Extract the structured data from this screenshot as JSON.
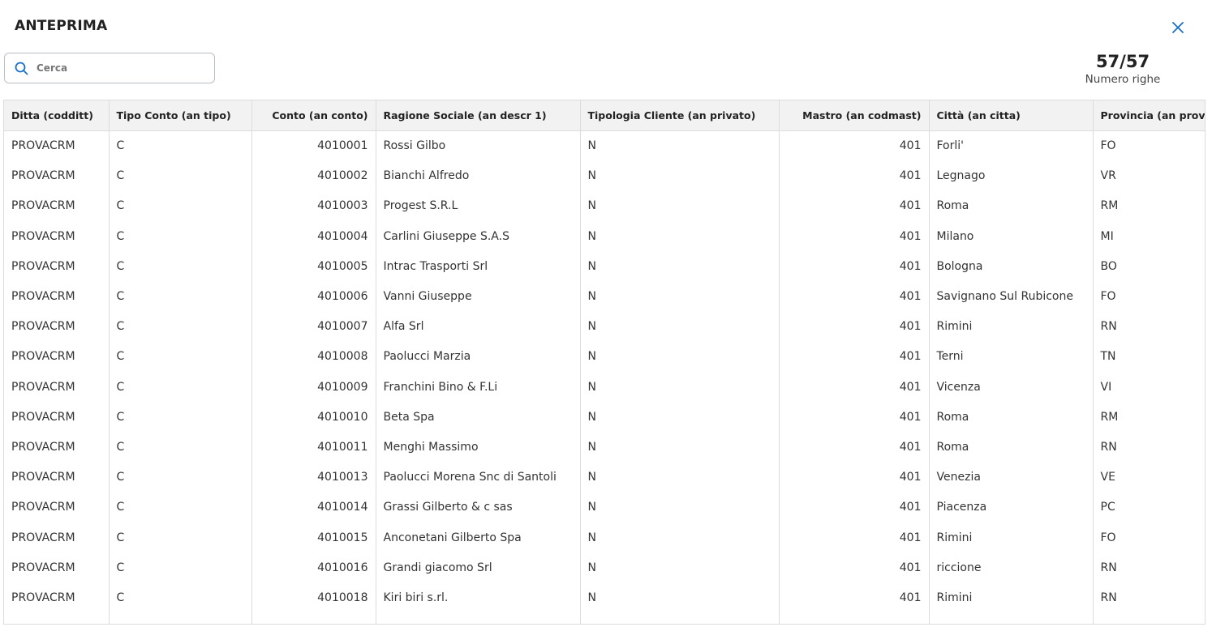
{
  "dialog": {
    "title": "ANTEPRIMA",
    "close_icon": "close-icon",
    "accent_color": "#1a6fc9"
  },
  "search": {
    "placeholder": "Cerca",
    "value": "",
    "icon": "search-icon"
  },
  "counter": {
    "count": "57/57",
    "label": "Numero righe"
  },
  "table": {
    "columns": [
      "Ditta (codditt)",
      "Tipo Conto (an tipo)",
      "Conto (an conto)",
      "Ragione Sociale (an descr 1)",
      "Tipologia Cliente (an privato)",
      "Mastro (an codmast)",
      "Città (an citta)",
      "Provincia (an prov)"
    ],
    "rows": [
      [
        "PROVACRM",
        "C",
        "4010001",
        "Rossi Gilbo",
        "N",
        "401",
        "Forli'",
        "FO"
      ],
      [
        "PROVACRM",
        "C",
        "4010002",
        "Bianchi Alfredo",
        "N",
        "401",
        "Legnago",
        "VR"
      ],
      [
        "PROVACRM",
        "C",
        "4010003",
        "Progest S.R.L",
        "N",
        "401",
        "Roma",
        "RM"
      ],
      [
        "PROVACRM",
        "C",
        "4010004",
        "Carlini Giuseppe S.A.S",
        "N",
        "401",
        "Milano",
        "MI"
      ],
      [
        "PROVACRM",
        "C",
        "4010005",
        "Intrac Trasporti Srl",
        "N",
        "401",
        "Bologna",
        "BO"
      ],
      [
        "PROVACRM",
        "C",
        "4010006",
        "Vanni Giuseppe",
        "N",
        "401",
        "Savignano Sul Rubicone",
        "FO"
      ],
      [
        "PROVACRM",
        "C",
        "4010007",
        "Alfa Srl",
        "N",
        "401",
        "Rimini",
        "RN"
      ],
      [
        "PROVACRM",
        "C",
        "4010008",
        "Paolucci Marzia",
        "N",
        "401",
        "Terni",
        "TN"
      ],
      [
        "PROVACRM",
        "C",
        "4010009",
        "Franchini Bino & F.Li",
        "N",
        "401",
        "Vicenza",
        "VI"
      ],
      [
        "PROVACRM",
        "C",
        "4010010",
        "Beta Spa",
        "N",
        "401",
        "Roma",
        "RM"
      ],
      [
        "PROVACRM",
        "C",
        "4010011",
        "Menghi Massimo",
        "N",
        "401",
        "Roma",
        "RN"
      ],
      [
        "PROVACRM",
        "C",
        "4010013",
        "Paolucci Morena Snc di Santoli",
        "N",
        "401",
        "Venezia",
        "VE"
      ],
      [
        "PROVACRM",
        "C",
        "4010014",
        "Grassi Gilberto & c sas",
        "N",
        "401",
        "Piacenza",
        "PC"
      ],
      [
        "PROVACRM",
        "C",
        "4010015",
        "Anconetani Gilberto Spa",
        "N",
        "401",
        "Rimini",
        "FO"
      ],
      [
        "PROVACRM",
        "C",
        "4010016",
        "Grandi giacomo Srl",
        "N",
        "401",
        "riccione",
        "RN"
      ],
      [
        "PROVACRM",
        "C",
        "4010018",
        "Kiri biri s.rl.",
        "N",
        "401",
        "Rimini",
        "RN"
      ]
    ]
  }
}
